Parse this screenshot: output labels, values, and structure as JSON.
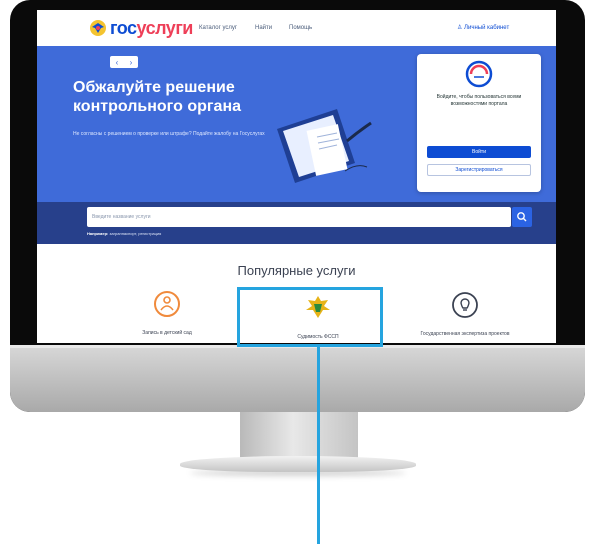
{
  "header": {
    "logo": {
      "part1": "гос",
      "part2": "услуги"
    },
    "nav": [
      "Каталог услуг",
      "Найти",
      "Помощь"
    ],
    "login": "Личный кабинет"
  },
  "hero": {
    "controls": {
      "prev": "‹",
      "next": "›"
    },
    "title": "Обжалуйте решение контрольного органа",
    "subtitle": "Не согласны с решением о проверке или штрафе? Подайте жалобу на Госуслугах",
    "card": {
      "text": "Войдите, чтобы пользоваться всеми возможностями портала",
      "primary_button": "Войти",
      "secondary_button": "Зарегистрироваться"
    }
  },
  "search": {
    "placeholder": "Введите название услуги",
    "hint_label": "Например:",
    "hint_text": "загранпаспорт, регистрация"
  },
  "popular": {
    "title": "Популярные услуги",
    "items": [
      {
        "label": "Запись в детский сад"
      },
      {
        "label": "Судимость ФССП"
      },
      {
        "label": "Государственная экспертиза проектов"
      }
    ]
  },
  "colors": {
    "accent": "#0d4cd3",
    "hero_bg": "#3f6bd9",
    "search_bg": "#27408b",
    "highlight": "#25a4df"
  }
}
